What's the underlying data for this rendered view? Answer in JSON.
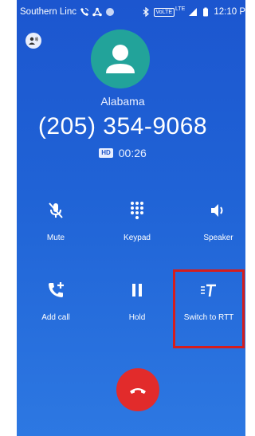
{
  "statusbar": {
    "carrier": "Southern Linc",
    "volte": "VoLTE",
    "network": "LTE",
    "time": "12:10 P"
  },
  "call": {
    "location": "Alabama",
    "phone": "(205) 354-9068",
    "hd_badge": "HD",
    "timer": "00:26"
  },
  "controls": {
    "mute": "Mute",
    "keypad": "Keypad",
    "speaker": "Speaker",
    "add_call": "Add call",
    "hold": "Hold",
    "switch_rtt": "Switch to RTT"
  },
  "icons": {
    "rtt_chip": "rtt-mode-icon",
    "avatar": "contact-avatar-icon",
    "mute": "mic-off-icon",
    "keypad": "dialpad-icon",
    "speaker": "volume-icon",
    "add_call": "add-call-icon",
    "hold": "pause-icon",
    "rtt": "rtt-icon",
    "end_call": "end-call-icon"
  },
  "colors": {
    "background": "#2063d6",
    "avatar": "#22a39a",
    "end_call": "#e22b2b",
    "highlight": "#d51d1d"
  }
}
